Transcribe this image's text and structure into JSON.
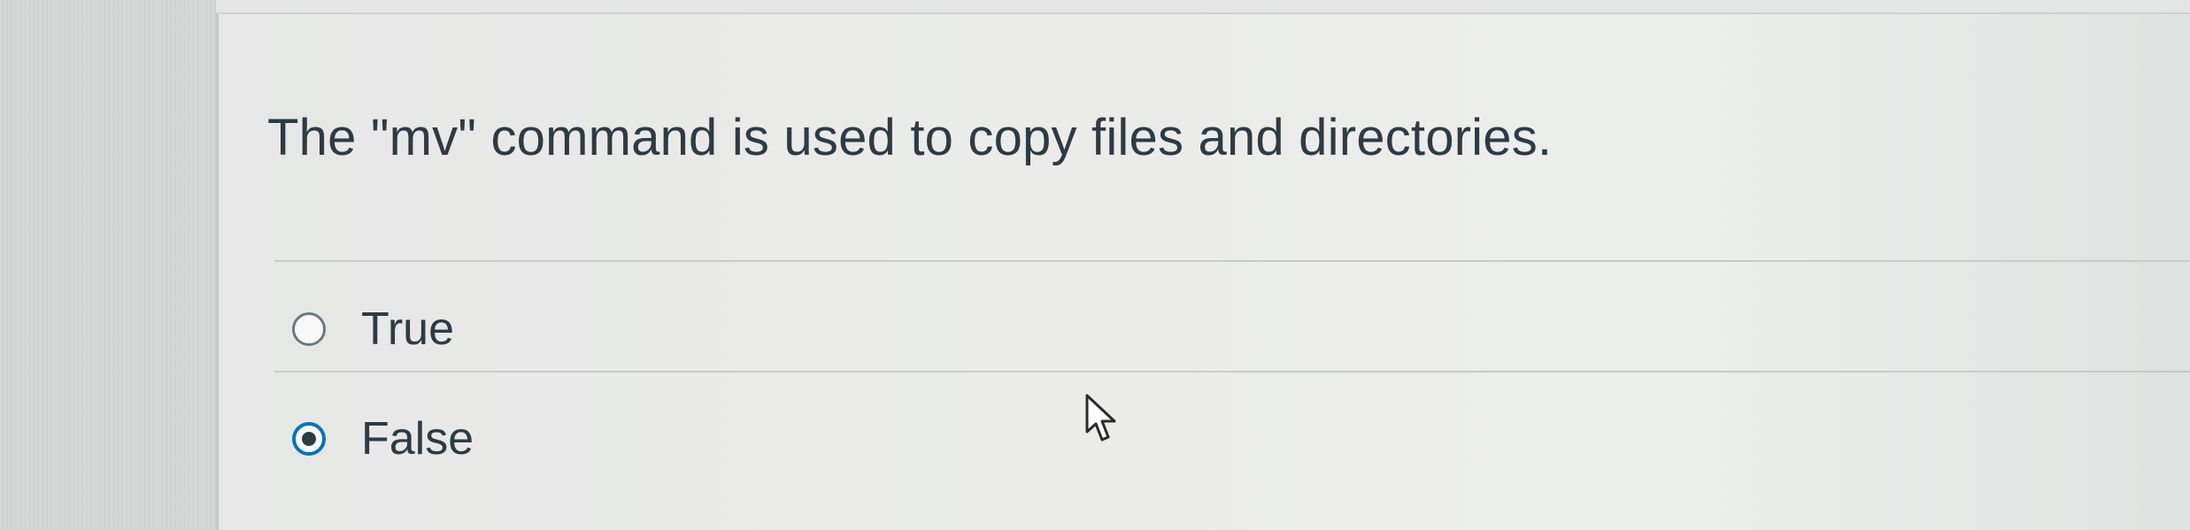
{
  "question": {
    "text": "The \"mv\" command is used to copy files and directories."
  },
  "answers": [
    {
      "label": "True",
      "selected": false
    },
    {
      "label": "False",
      "selected": true
    }
  ],
  "icons": {
    "pointer": "mouse-pointer-icon",
    "radio": "radio-button-icon"
  },
  "colors": {
    "text": "#2d3b45",
    "selected_ring": "#0374b5",
    "unselected_ring": "#6b7780",
    "background": "#e8e9e8"
  }
}
